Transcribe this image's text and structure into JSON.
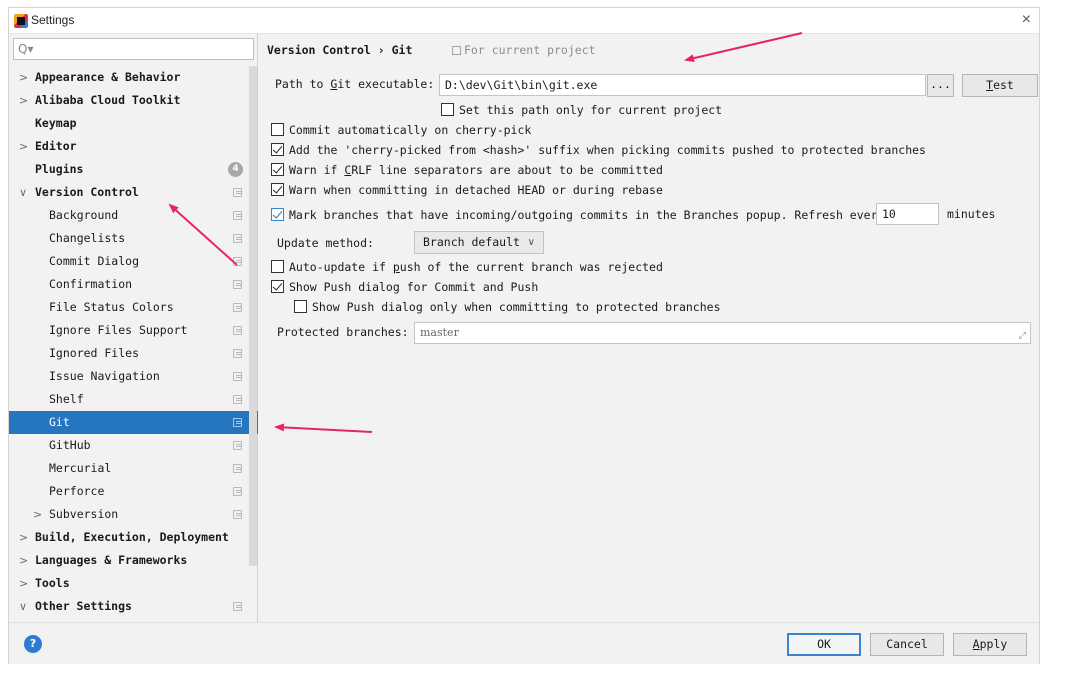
{
  "window": {
    "title": "Settings",
    "close_glyph": "×"
  },
  "search": {
    "placeholder": "Q▾"
  },
  "sidebar": {
    "items": [
      {
        "label": "Appearance & Behavior",
        "arrow": ">"
      },
      {
        "label": "Alibaba Cloud Toolkit",
        "arrow": ">"
      },
      {
        "label": "Keymap",
        "arrow": ""
      },
      {
        "label": "Editor",
        "arrow": ">"
      },
      {
        "label": "Plugins",
        "arrow": "",
        "badge": "4"
      },
      {
        "label": "Version Control",
        "arrow": "∨"
      },
      {
        "label": "Background"
      },
      {
        "label": "Changelists"
      },
      {
        "label": "Commit Dialog"
      },
      {
        "label": "Confirmation"
      },
      {
        "label": "File Status Colors"
      },
      {
        "label": "Ignore Files Support"
      },
      {
        "label": "Ignored Files"
      },
      {
        "label": "Issue Navigation"
      },
      {
        "label": "Shelf"
      },
      {
        "label": "Git"
      },
      {
        "label": "GitHub"
      },
      {
        "label": "Mercurial"
      },
      {
        "label": "Perforce"
      },
      {
        "label": "Subversion",
        "arrow": ">"
      },
      {
        "label": "Build, Execution, Deployment",
        "arrow": ">"
      },
      {
        "label": "Languages & Frameworks",
        "arrow": ">"
      },
      {
        "label": "Tools",
        "arrow": ">"
      },
      {
        "label": "Other Settings",
        "arrow": "∨"
      }
    ]
  },
  "panel": {
    "breadcrumb": "Version Control › Git",
    "for_project": "For current project",
    "path_label_pre": "Path to ",
    "path_label_u": "G",
    "path_label_post": "it executable:",
    "path_value": "D:\\dev\\Git\\bin\\git.exe",
    "browse_label": "...",
    "test_u": "T",
    "test_rest": "est",
    "set_path_only": "Set this path only for current project",
    "commit_auto": "Commit automatically on cherry-pick",
    "cherry_suffix": "Add the 'cherry-picked from <hash>' suffix when picking commits pushed to protected branches",
    "warn_crlf_pre": "Warn if ",
    "warn_crlf_u": "C",
    "warn_crlf_post": "RLF line separators are about to be committed",
    "warn_detached": "Warn when committing in detached HEAD or during rebase",
    "mark_branches": "Mark branches that have incoming/outgoing commits in the Branches popup.  Refresh every",
    "refresh_value": "10",
    "minutes": "minutes",
    "update_method_label": "Update method:",
    "update_method_value": "Branch default",
    "auto_update_pre": "Auto-update if ",
    "auto_update_u": "p",
    "auto_update_post": "ush of the current branch was rejected",
    "show_push": "Show Push dialog for Commit and Push",
    "show_push_protected": "Show Push dialog only when committing to protected branches",
    "protected_label": "Protected branches:",
    "protected_value": "master"
  },
  "footer": {
    "help": "?",
    "ok": "OK",
    "cancel": "Cancel",
    "apply_u": "A",
    "apply_rest": "pply"
  },
  "colors": {
    "selection": "#2675bf",
    "annotation_arrow": "#e6246e",
    "help_button": "#2e7bd3"
  }
}
